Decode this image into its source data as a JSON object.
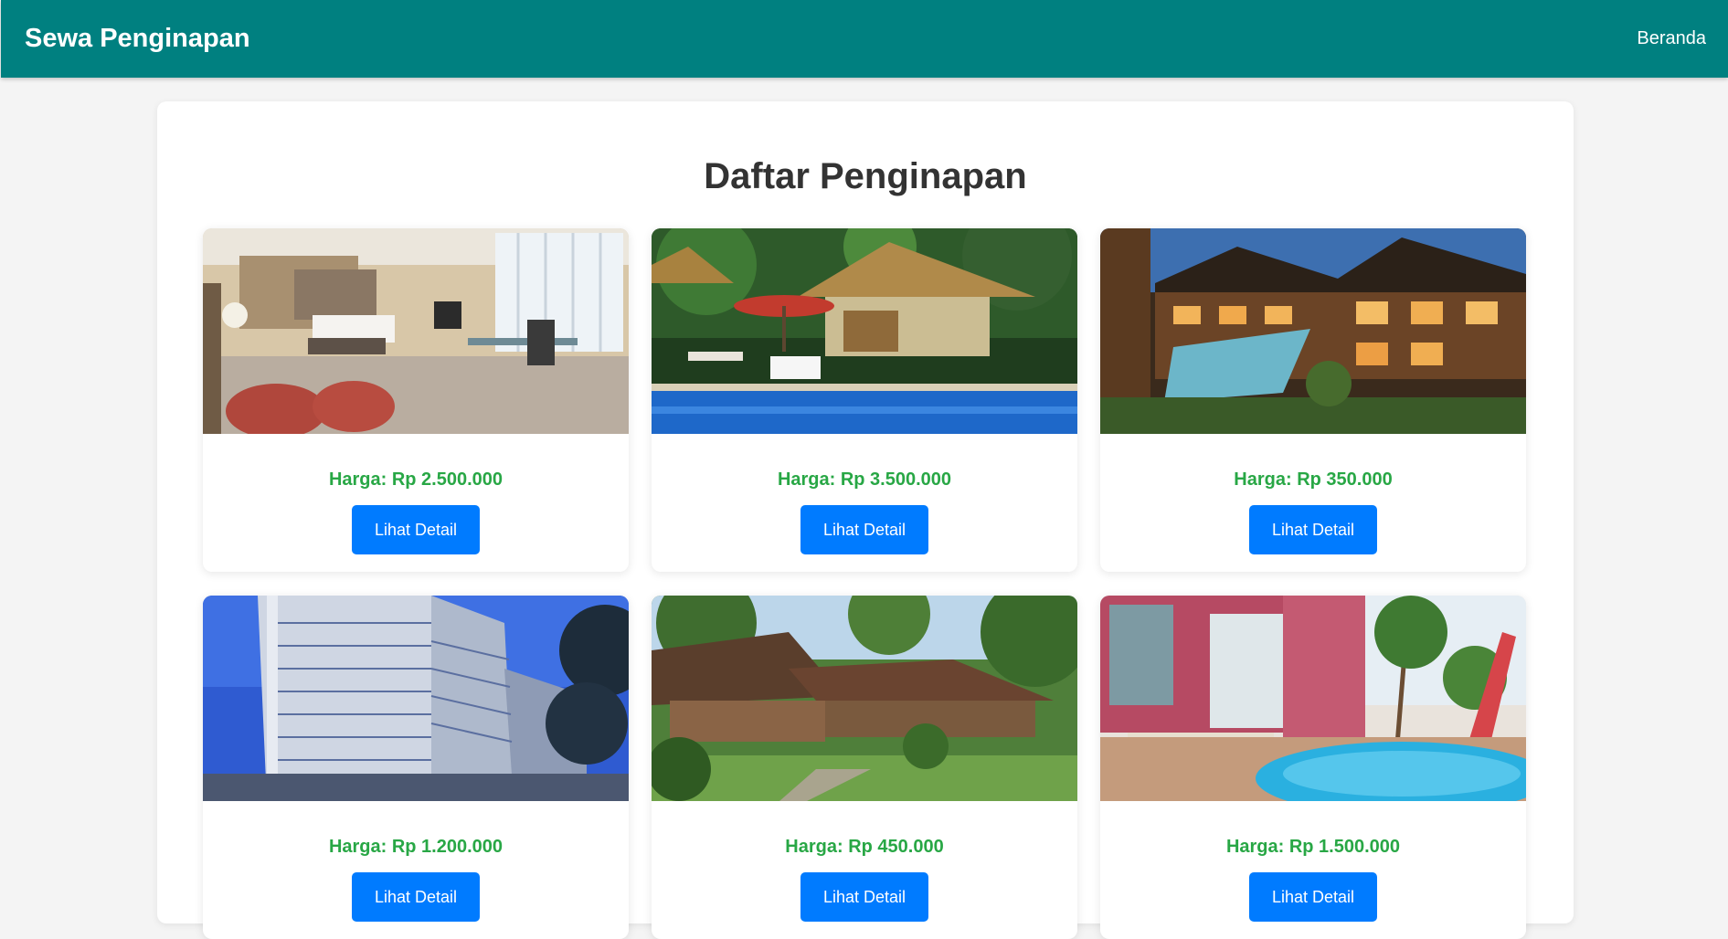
{
  "navbar": {
    "brand": "Sewa Penginapan",
    "links": [
      "Beranda"
    ]
  },
  "main": {
    "title": "Daftar Penginapan"
  },
  "listings": [
    {
      "price": "Harga: Rp 2.500.000",
      "button": "Lihat Detail",
      "photo": "hotel-room-photo"
    },
    {
      "price": "Harga: Rp 3.500.000",
      "button": "Lihat Detail",
      "photo": "pool-villa-photo"
    },
    {
      "price": "Harga: Rp 350.000",
      "button": "Lihat Detail",
      "photo": "wooden-resort-pool-photo"
    },
    {
      "price": "Harga: Rp 1.200.000",
      "button": "Lihat Detail",
      "photo": "high-rise-hotel-photo"
    },
    {
      "price": "Harga: Rp 450.000",
      "button": "Lihat Detail",
      "photo": "garden-cottage-photo"
    },
    {
      "price": "Harga: Rp 1.500.000",
      "button": "Lihat Detail",
      "photo": "poolside-hotel-photo"
    }
  ],
  "colors": {
    "navbar": "#008080",
    "price": "#28a745",
    "button": "#007bff",
    "background": "#f4f4f4"
  }
}
